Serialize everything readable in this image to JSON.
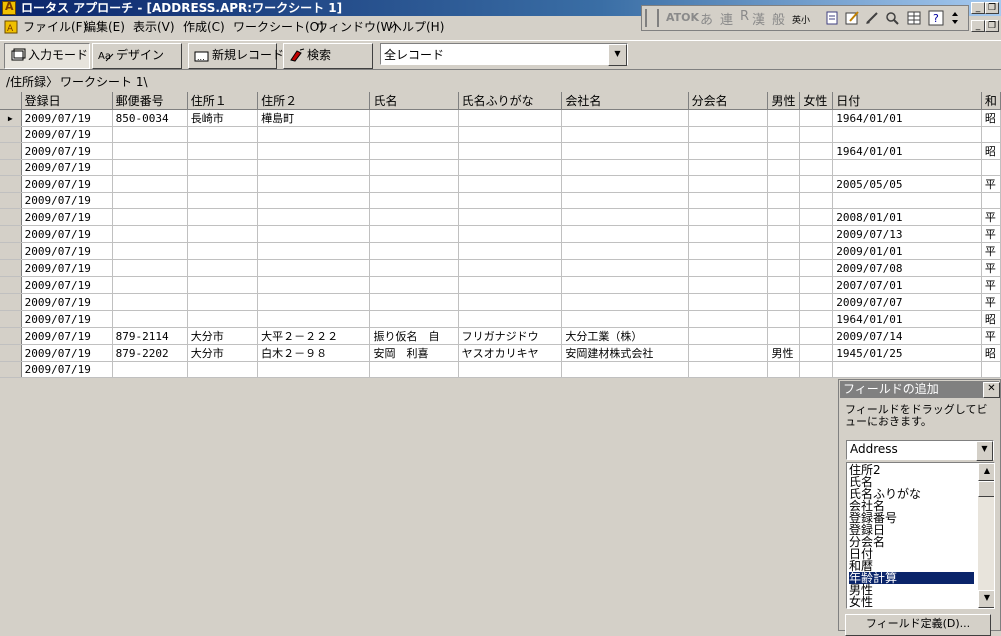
{
  "window": {
    "title": "ロータス アプローチ - [ADDRESS.APR:ワークシート 1]"
  },
  "menubar": {
    "items": [
      "ファイル(F)",
      "編集(E)",
      "表示(V)",
      "作成(C)",
      "ワークシート(O)",
      "ウィンドウ(W)",
      "ヘルプ(H)"
    ]
  },
  "ime": {
    "mode_label": "ATOK",
    "a": "あ",
    "ren": "連",
    "r": "R",
    "kan": "漢",
    "han": "般",
    "eishou": "英小"
  },
  "toolbar": {
    "input_mode": "入力モード",
    "design": "デザイン",
    "new_record": "新規レコード",
    "search": "検索",
    "record_filter": "全レコード"
  },
  "tabs": [
    "住所録",
    "ワークシート 1"
  ],
  "grid": {
    "columns": [
      "登録日",
      "郵便番号",
      "住所１",
      "住所２",
      "氏名",
      "氏名ふりがな",
      "会社名",
      "分会名",
      "男性",
      "女性",
      "日付",
      "和"
    ],
    "rows": [
      [
        "2009/07/19",
        "850-0034",
        "長崎市",
        "樺島町",
        "",
        "",
        "",
        "",
        "",
        "",
        "1964/01/01",
        "昭"
      ],
      [
        "2009/07/19",
        "",
        "",
        "",
        "",
        "",
        "",
        "",
        "",
        "",
        "",
        ""
      ],
      [
        "2009/07/19",
        "",
        "",
        "",
        "",
        "",
        "",
        "",
        "",
        "",
        "1964/01/01",
        "昭"
      ],
      [
        "2009/07/19",
        "",
        "",
        "",
        "",
        "",
        "",
        "",
        "",
        "",
        "",
        ""
      ],
      [
        "2009/07/19",
        "",
        "",
        "",
        "",
        "",
        "",
        "",
        "",
        "",
        "2005/05/05",
        "平"
      ],
      [
        "2009/07/19",
        "",
        "",
        "",
        "",
        "",
        "",
        "",
        "",
        "",
        "",
        ""
      ],
      [
        "2009/07/19",
        "",
        "",
        "",
        "",
        "",
        "",
        "",
        "",
        "",
        "2008/01/01",
        "平"
      ],
      [
        "2009/07/19",
        "",
        "",
        "",
        "",
        "",
        "",
        "",
        "",
        "",
        "2009/07/13",
        "平"
      ],
      [
        "2009/07/19",
        "",
        "",
        "",
        "",
        "",
        "",
        "",
        "",
        "",
        "2009/01/01",
        "平"
      ],
      [
        "2009/07/19",
        "",
        "",
        "",
        "",
        "",
        "",
        "",
        "",
        "",
        "2009/07/08",
        "平"
      ],
      [
        "2009/07/19",
        "",
        "",
        "",
        "",
        "",
        "",
        "",
        "",
        "",
        "2007/07/01",
        "平"
      ],
      [
        "2009/07/19",
        "",
        "",
        "",
        "",
        "",
        "",
        "",
        "",
        "",
        "2009/07/07",
        "平"
      ],
      [
        "2009/07/19",
        "",
        "",
        "",
        "",
        "",
        "",
        "",
        "",
        "",
        "1964/01/01",
        "昭"
      ],
      [
        "2009/07/19",
        "879-2114",
        "大分市",
        "大平２－２２２",
        "振り仮名　自",
        "フリガナジドウ",
        "大分工業（株）",
        "",
        "",
        "",
        "2009/07/14",
        "平"
      ],
      [
        "2009/07/19",
        "879-2202",
        "大分市",
        "白木２－９８",
        "安岡　利喜",
        "ヤスオカリキヤ",
        "安岡建材株式会社",
        "",
        "男性",
        "",
        "1945/01/25",
        "昭"
      ],
      [
        "2009/07/19",
        "",
        "",
        "",
        "",
        "",
        "",
        "",
        "",
        "",
        "",
        ""
      ]
    ]
  },
  "field_panel": {
    "title": "フィールドの追加",
    "close": "✕",
    "help": "フィールドをドラッグしてビューにおきます。",
    "source": "Address",
    "items": [
      "住所2",
      "氏名",
      "氏名ふりがな",
      "会社名",
      "登録番号",
      "登録日",
      "分会名",
      "日付",
      "和暦",
      "年齢計算",
      "男性",
      "女性"
    ],
    "selected_index": 9,
    "define_button": "フィールド定義(D)..."
  }
}
